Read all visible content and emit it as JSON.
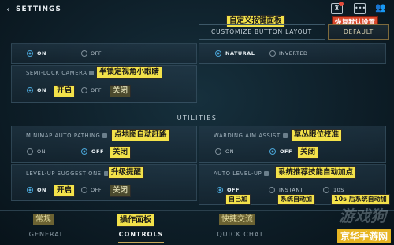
{
  "header": {
    "title": "SETTINGS",
    "customize_annotation": "自定义按键面板",
    "customize_button": "CUSTOMIZE BUTTON LAYOUT",
    "default_annotation": "恢复默认设置",
    "default_button": "DEFAULT"
  },
  "top_panel_left": {
    "on": "ON",
    "off": "OFF"
  },
  "top_panel_right": {
    "natural": "NATURAL",
    "inverted": "INVERTED"
  },
  "semi_lock": {
    "title": "SEMI-LOCK CAMERA",
    "annotation": "半锁定视角小眼睛",
    "on": "ON",
    "on_ann": "开启",
    "off": "OFF",
    "off_ann": "关闭"
  },
  "utilities_title": "UTILITIES",
  "minimap": {
    "title": "MINIMAP AUTO PATHING",
    "annotation": "点地图自动赶路",
    "on": "ON",
    "off": "OFF",
    "off_ann": "关闭"
  },
  "warding": {
    "title": "WARDING AIM ASSIST",
    "annotation": "草丛眼位校准",
    "on": "ON",
    "off": "OFF",
    "off_ann": "关闭"
  },
  "level_suggest": {
    "title": "LEVEL-UP SUGGESTIONS",
    "annotation": "升级提醒",
    "on": "ON",
    "on_ann": "开启",
    "off": "OFF",
    "off_ann": "关闭"
  },
  "auto_level": {
    "title": "AUTO LEVEL-UP",
    "annotation": "系统推荐技能自动加点",
    "off": "OFF",
    "off_ann": "自己加",
    "instant": "INSTANT",
    "instant_ann": "系统自动加",
    "s10": "10S",
    "s10_ann": "10s 后系统自动加"
  },
  "nav": [
    {
      "label": "GENERAL",
      "annotation": "常规"
    },
    {
      "label": "CONTROLS",
      "annotation": "操作面板"
    },
    {
      "label": "QUICK CHAT",
      "annotation": "快捷交流"
    },
    {
      "label": "",
      "annotation": ""
    }
  ],
  "watermark": {
    "top": "游戏狗",
    "bottom": "京华手游网"
  },
  "colors": {
    "accent": "#4aa6d8",
    "annotation": "#f3e24a",
    "annotation_red": "#d9492c",
    "active_underline": "#c9a85a"
  }
}
